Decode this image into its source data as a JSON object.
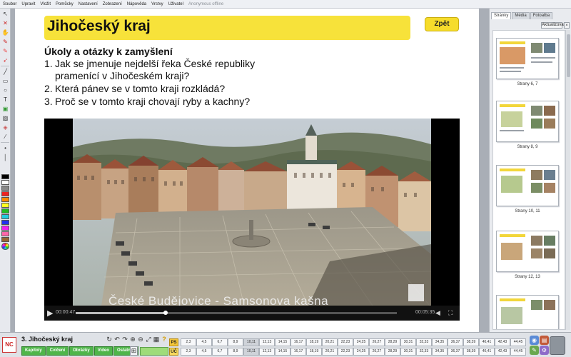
{
  "menu": [
    "Soubor",
    "Upravit",
    "Vložit",
    "Pomůcky",
    "Nastavení",
    "Zobrazení",
    "Nápověda",
    "Vrstvy",
    "Uživatel",
    "Anonymous offline"
  ],
  "page": {
    "title": "Jihočeský kraj",
    "back_button": "Zpět",
    "heading": "Úkoly a otázky k zamyšlení",
    "questions": [
      {
        "num": "1.",
        "line1": "Jak se jmenuje nejdelší řeka České republiky",
        "line2": "pramenící v Jihočeském kraji?"
      },
      {
        "num": "2.",
        "line1": "Která pánev se v tomto kraji rozkládá?"
      },
      {
        "num": "3.",
        "line1": "Proč se v tomto kraji chovají ryby a kachny?"
      }
    ]
  },
  "video": {
    "caption": "České Budějovice - Samsonova kašna",
    "time_current": "00:00:47",
    "time_total": "00:05:35",
    "progress": 0.28
  },
  "sidebar": {
    "tabs": [
      "Stránky",
      "Média",
      "Fotoalba"
    ],
    "refresh_label": "Aktualizovat",
    "close_label": "×",
    "thumbnails": [
      {
        "label": "Strany 6, 7"
      },
      {
        "label": "Strany 8, 9"
      },
      {
        "label": "Strany 10, 11"
      },
      {
        "label": "Strany 12, 13"
      },
      {
        "label": ""
      }
    ]
  },
  "bottom": {
    "title": "3. Jihočeský kraj",
    "nav_buttons": [
      "Kapitoly",
      "Cvičení",
      "Obrázky",
      "Video",
      "Ostatní ▾"
    ],
    "logo": "NC",
    "ps_label": "PS",
    "uc_label": "UČ",
    "ps_pages": [
      "2,3",
      "4,5",
      "6,7",
      "8,9",
      "10,11",
      "12,13",
      "14,15",
      "16,17",
      "18,19",
      "20,21",
      "22,23",
      "24,25",
      "26,27",
      "28,29",
      "30,31",
      "32,33",
      "34,35",
      "36,37",
      "38,39",
      "40,41",
      "42,43",
      "44,45"
    ],
    "uc_pages": [
      "2,3",
      "4,5",
      "6,7",
      "8,9",
      "10,11",
      "12,13",
      "14,15",
      "16,17",
      "18,19",
      "20,21",
      "22,23",
      "24,25",
      "26,27",
      "28,29",
      "30,31",
      "32,33",
      "34,35",
      "36,37",
      "38,39",
      "40,41",
      "42,43",
      "44,45"
    ]
  },
  "colors": {
    "title_bg": "#f7e23a",
    "nav_green": "#4fb54a",
    "ps_yellow": "#f2c53a"
  }
}
